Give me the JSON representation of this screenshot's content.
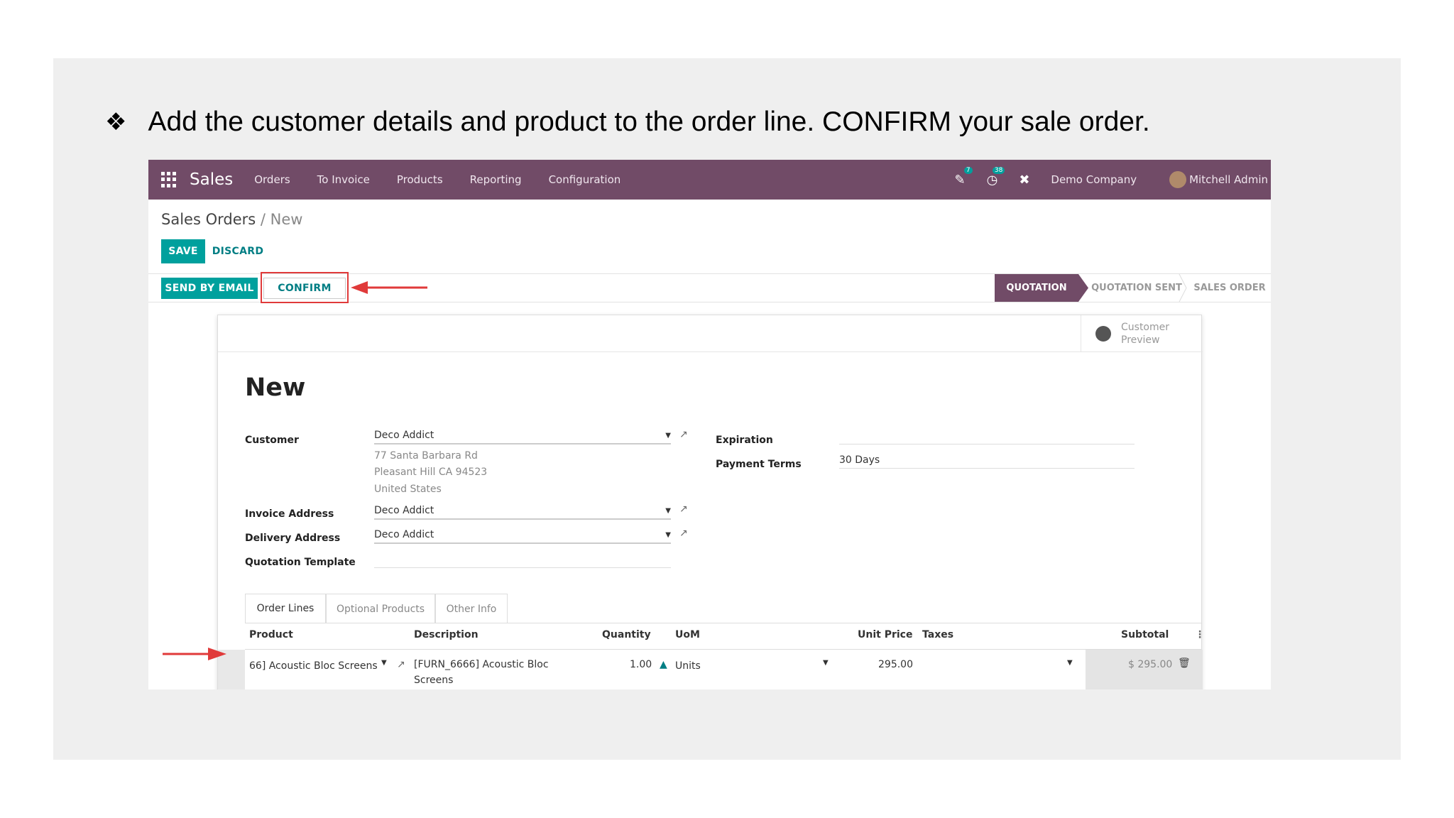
{
  "caption": {
    "bullet": "❖",
    "text": "Add the customer details and product to the order line. CONFIRM your sale order."
  },
  "navbar": {
    "app_name": "Sales",
    "menu": [
      "Orders",
      "To Invoice",
      "Products",
      "Reporting",
      "Configuration"
    ],
    "messages_badge": "7",
    "activities_badge": "38",
    "company": "Demo Company",
    "user": "Mitchell Admin"
  },
  "breadcrumb": {
    "parent": "Sales Orders",
    "separator": " / ",
    "current": "New"
  },
  "actions": {
    "save": "SAVE",
    "discard": "DISCARD",
    "send_by_email": "SEND BY EMAIL",
    "confirm": "CONFIRM"
  },
  "stages": [
    "QUOTATION",
    "QUOTATION SENT",
    "SALES ORDER"
  ],
  "customer_preview": "Customer Preview",
  "form": {
    "title": "New",
    "customer_label": "Customer",
    "customer": "Deco Addict",
    "address_line1": "77 Santa Barbara Rd",
    "address_line2": "Pleasant Hill CA 94523",
    "address_line3": "United States",
    "invoice_address_label": "Invoice Address",
    "invoice_address": "Deco Addict",
    "delivery_address_label": "Delivery Address",
    "delivery_address": "Deco Addict",
    "quotation_template_label": "Quotation Template",
    "quotation_template": "",
    "expiration_label": "Expiration",
    "expiration": "",
    "payment_terms_label": "Payment Terms",
    "payment_terms": "30 Days"
  },
  "tabs": [
    "Order Lines",
    "Optional Products",
    "Other Info"
  ],
  "order_lines": {
    "headers": [
      "Product",
      "Description",
      "Quantity",
      "UoM",
      "Unit Price",
      "Taxes",
      "Subtotal"
    ],
    "rows": [
      {
        "product": "66] Acoustic Bloc Screens",
        "description_line1": "[FURN_6666] Acoustic Bloc",
        "description_line2": "Screens",
        "quantity": "1.00",
        "uom": "Units",
        "unit_price": "295.00",
        "taxes": "",
        "subtotal": "$ 295.00"
      }
    ]
  },
  "colors": {
    "navbar": "#714b67",
    "primary_button": "#00a09d",
    "highlight": "#e03a3a"
  }
}
